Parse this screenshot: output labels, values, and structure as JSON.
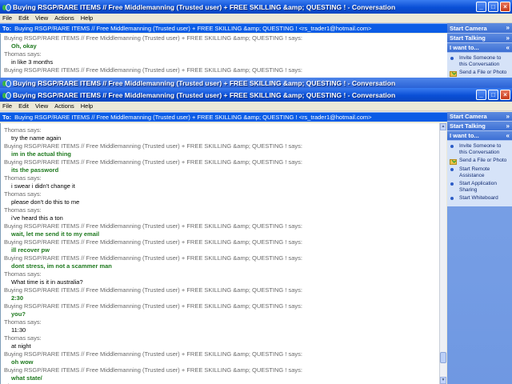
{
  "window_back": {
    "title": "Buying RSGP/RARE ITEMS // Free Middlemanning (Trusted user) + FREE SKILLING &amp; QUESTING ! - Conversation",
    "menu": [
      "File",
      "Edit",
      "View",
      "Actions",
      "Help"
    ],
    "to_label": "To:",
    "to_value": "Buying RSGP/RARE ITEMS // Free Middlemanning (Trusted user) + FREE SKILLING &amp; QUESTING ! <rs_trader1@hotmail.com>",
    "messages": [
      {
        "speaker": "Buying RSGP/RARE ITEMS // Free Middlemanning (Trusted user) + FREE SKILLING &amp; QUESTING ! says:",
        "text": "Oh, okay",
        "self": true
      },
      {
        "speaker": "Thomas says:",
        "text": "in like 3 months",
        "self": false
      },
      {
        "speaker": "Buying RSGP/RARE ITEMS // Free Middlemanning (Trusted user) + FREE SKILLING &amp; QUESTING ! says:",
        "text": "",
        "self": true
      }
    ],
    "sidebar": {
      "start_camera": "Start Camera",
      "start_talking": "Start Talking",
      "i_want_to": "I want to...",
      "items": [
        {
          "icon": "invite-icon",
          "label": "Invite Someone to this Conversation"
        },
        {
          "icon": "send-file-icon",
          "label": "Send a File or Photo"
        }
      ]
    }
  },
  "window_front": {
    "title": "Buying RSGP/RARE ITEMS // Free Middlemanning (Trusted user) + FREE SKILLING &amp; QUESTING ! - Conversation",
    "menu": [
      "File",
      "Edit",
      "View",
      "Actions",
      "Help"
    ],
    "to_label": "To:",
    "to_value": "Buying RSGP/RARE ITEMS // Free Middlemanning (Trusted user) + FREE SKILLING &amp; QUESTING ! <rs_trader1@hotmail.com>",
    "messages": [
      {
        "speaker": "Thomas says:",
        "text": "try the name again",
        "self": false
      },
      {
        "speaker": "Buying RSGP/RARE ITEMS // Free Middlemanning (Trusted user) + FREE SKILLING &amp; QUESTING ! says:",
        "text": "im in the actual thing",
        "self": true
      },
      {
        "speaker": "Buying RSGP/RARE ITEMS // Free Middlemanning (Trusted user) + FREE SKILLING &amp; QUESTING ! says:",
        "text": "its the password",
        "self": true
      },
      {
        "speaker": "Thomas says:",
        "text": "i swear i didn't change it",
        "self": false
      },
      {
        "speaker": "Thomas says:",
        "text": "please don't do this to me",
        "self": false
      },
      {
        "speaker": "Thomas says:",
        "text": "i've heard this a ton",
        "self": false
      },
      {
        "speaker": "Buying RSGP/RARE ITEMS // Free Middlemanning (Trusted user) + FREE SKILLING &amp; QUESTING ! says:",
        "text": "wait, let me send it to my email",
        "self": true
      },
      {
        "speaker": "Buying RSGP/RARE ITEMS // Free Middlemanning (Trusted user) + FREE SKILLING &amp; QUESTING ! says:",
        "text": "ill recover pw",
        "self": true
      },
      {
        "speaker": "Buying RSGP/RARE ITEMS // Free Middlemanning (Trusted user) + FREE SKILLING &amp; QUESTING ! says:",
        "text": "dont stress, im not a scammer man",
        "self": true
      },
      {
        "speaker": "Thomas says:",
        "text": "What time is it in australia?",
        "self": false
      },
      {
        "speaker": "Buying RSGP/RARE ITEMS // Free Middlemanning (Trusted user) + FREE SKILLING &amp; QUESTING ! says:",
        "text": "2:30",
        "self": true
      },
      {
        "speaker": "Buying RSGP/RARE ITEMS // Free Middlemanning (Trusted user) + FREE SKILLING &amp; QUESTING ! says:",
        "text": "you?",
        "self": true
      },
      {
        "speaker": "Thomas says:",
        "text": "11:30",
        "self": false
      },
      {
        "speaker": "Thomas says:",
        "text": "at night",
        "self": false
      },
      {
        "speaker": "Buying RSGP/RARE ITEMS // Free Middlemanning (Trusted user) + FREE SKILLING &amp; QUESTING ! says:",
        "text": "oh wow",
        "self": true
      },
      {
        "speaker": "Buying RSGP/RARE ITEMS // Free Middlemanning (Trusted user) + FREE SKILLING &amp; QUESTING ! says:",
        "text": "what state/",
        "self": true
      },
      {
        "speaker": "Thomas says:",
        "text": "",
        "self": false
      }
    ],
    "sidebar": {
      "start_camera": "Start Camera",
      "start_talking": "Start Talking",
      "i_want_to": "I want to...",
      "items": [
        {
          "icon": "invite-icon",
          "label": "Invite Someone to this Conversation"
        },
        {
          "icon": "send-file-icon",
          "label": "Send a File or Photo"
        },
        {
          "icon": "remote-assistance-icon",
          "label": "Start Remote Assistance"
        },
        {
          "icon": "app-sharing-icon",
          "label": "Start Application Sharing"
        },
        {
          "icon": "whiteboard-icon",
          "label": "Start Whiteboard"
        }
      ]
    }
  },
  "colors": {
    "title_blue": "#0a4fd6",
    "self_text": "#1f7a1f",
    "speaker_gray": "#6a6a6a",
    "sidebar_blue": "#6f98e2"
  }
}
